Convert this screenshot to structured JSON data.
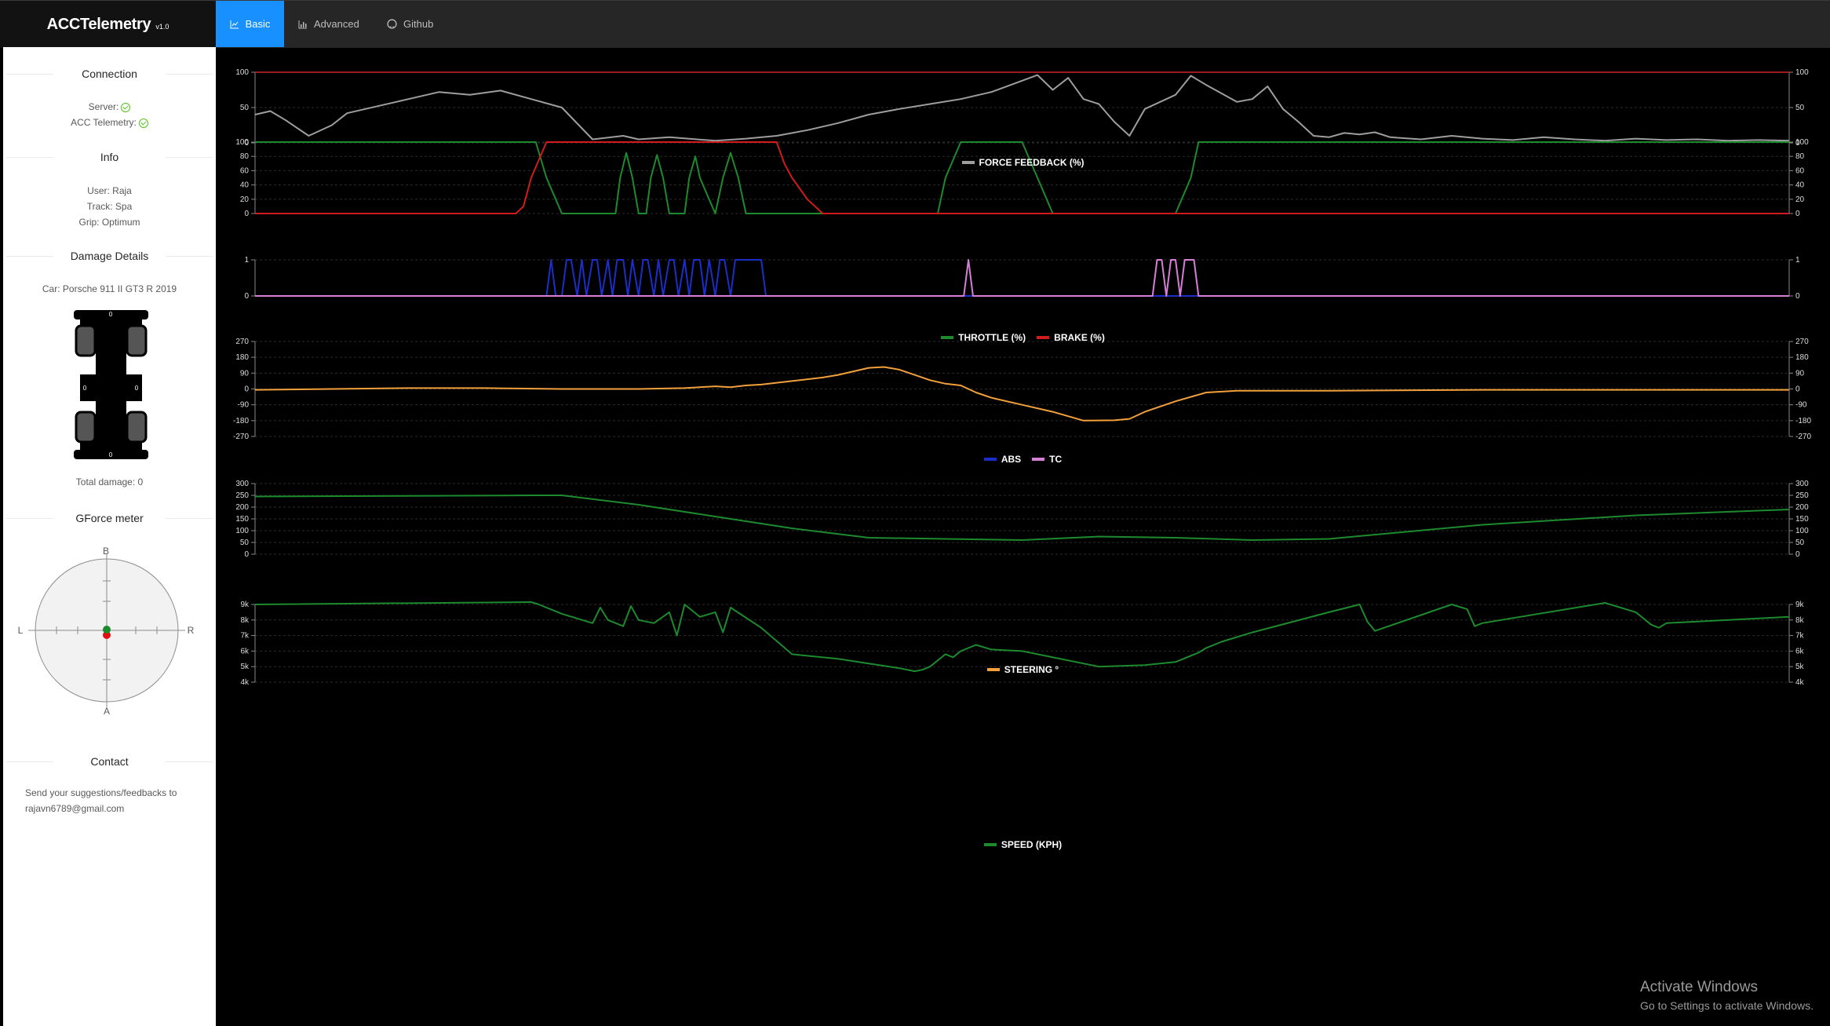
{
  "app": {
    "title": "ACCTelemetry",
    "version": "v1.0"
  },
  "nav": {
    "tabs": [
      "Basic",
      "Advanced",
      "Github"
    ],
    "active": "Basic",
    "accent": "#1890ff"
  },
  "sidebar": {
    "connection": {
      "title": "Connection",
      "server_label": "Server:",
      "telemetry_label": "ACC Telemetry:",
      "server_ok": true,
      "telemetry_ok": true
    },
    "info": {
      "title": "Info",
      "user": "User: Raja",
      "track": "Track: Spa",
      "grip": "Grip: Optimum"
    },
    "damage": {
      "title": "Damage Details",
      "car": "Car: Porsche 911 II GT3 R 2019",
      "front": "0",
      "rear": "0",
      "left": "0",
      "right": "0",
      "total": "Total damage: 0"
    },
    "gforce": {
      "title": "GForce meter",
      "top": "B",
      "bottom": "A",
      "left": "L",
      "right": "R"
    },
    "contact": {
      "title": "Contact",
      "line1": "Send your suggestions/feedbacks to",
      "email": "rajavn6789@gmail.com"
    }
  },
  "windows_notice": {
    "line1": "Activate Windows",
    "line2": "Go to Settings to activate Windows."
  },
  "chart_data": [
    {
      "type": "line",
      "ylim": [
        0,
        100
      ],
      "ticks": [
        "0",
        "50",
        "100"
      ],
      "series": [
        {
          "name": "FORCE FEEDBACK (%)",
          "color": "#9e9e9e",
          "x": [
            0,
            0.01,
            0.02,
            0.035,
            0.05,
            0.06,
            0.08,
            0.1,
            0.12,
            0.14,
            0.16,
            0.18,
            0.2,
            0.22,
            0.24,
            0.25,
            0.27,
            0.3,
            0.32,
            0.34,
            0.36,
            0.38,
            0.4,
            0.42,
            0.44,
            0.46,
            0.48,
            0.5,
            0.51,
            0.52,
            0.53,
            0.54,
            0.55,
            0.56,
            0.57,
            0.58,
            0.6,
            0.61,
            0.62,
            0.63,
            0.64,
            0.65,
            0.66,
            0.67,
            0.68,
            0.69,
            0.7,
            0.71,
            0.72,
            0.73,
            0.74,
            0.76,
            0.78,
            0.8,
            0.82,
            0.84,
            0.86,
            0.88,
            0.9,
            0.92,
            0.94,
            0.96,
            0.98,
            1.0
          ],
          "y": [
            40,
            45,
            32,
            10,
            25,
            42,
            52,
            62,
            72,
            68,
            74,
            62,
            50,
            5,
            10,
            5,
            8,
            3,
            6,
            10,
            18,
            28,
            40,
            48,
            55,
            62,
            72,
            88,
            96,
            75,
            92,
            62,
            55,
            30,
            10,
            48,
            68,
            95,
            82,
            70,
            58,
            62,
            80,
            48,
            30,
            10,
            8,
            14,
            12,
            15,
            8,
            5,
            10,
            6,
            4,
            8,
            5,
            3,
            6,
            4,
            5,
            3,
            4,
            3
          ]
        },
        {
          "name": "",
          "color": "#9b1c1c",
          "x": [
            0,
            1
          ],
          "y": [
            100,
            100
          ]
        }
      ]
    },
    {
      "type": "line",
      "ylim": [
        0,
        100
      ],
      "ticks": [
        "0",
        "20",
        "40",
        "60",
        "80",
        "100"
      ],
      "series": [
        {
          "name": "THROTTLE (%)",
          "color": "#1d8a2e",
          "x": [
            0,
            0.183,
            0.19,
            0.2,
            0.21,
            0.215,
            0.22,
            0.235,
            0.238,
            0.242,
            0.246,
            0.25,
            0.255,
            0.258,
            0.262,
            0.266,
            0.27,
            0.28,
            0.283,
            0.287,
            0.29,
            0.3,
            0.305,
            0.31,
            0.315,
            0.32,
            0.33,
            0.34,
            0.44,
            0.445,
            0.45,
            0.46,
            0.48,
            0.5,
            0.51,
            0.52,
            0.6,
            0.61,
            0.615,
            0.62,
            0.63,
            1.0
          ],
          "y": [
            100,
            100,
            50,
            0,
            0,
            0,
            0,
            0,
            50,
            85,
            50,
            0,
            0,
            50,
            82,
            50,
            0,
            0,
            50,
            80,
            50,
            0,
            50,
            85,
            50,
            0,
            0,
            0,
            0,
            0,
            50,
            100,
            100,
            100,
            50,
            0,
            0,
            50,
            100,
            100,
            100,
            100
          ]
        },
        {
          "name": "BRAKE (%)",
          "color": "#d01c1c",
          "x": [
            0,
            0.17,
            0.175,
            0.18,
            0.19,
            0.2,
            0.33,
            0.34,
            0.345,
            0.35,
            0.36,
            0.37,
            1.0
          ],
          "y": [
            0,
            0,
            10,
            50,
            100,
            100,
            100,
            100,
            70,
            50,
            20,
            0,
            0
          ]
        }
      ]
    },
    {
      "type": "line",
      "ylim": [
        0,
        1
      ],
      "ticks": [
        "0",
        "1"
      ],
      "series": [
        {
          "name": "ABS",
          "color": "#1c2ec9",
          "x": [
            0,
            0.19,
            0.193,
            0.196,
            0.2,
            0.203,
            0.206,
            0.21,
            0.213,
            0.216,
            0.22,
            0.223,
            0.226,
            0.23,
            0.233,
            0.236,
            0.24,
            0.243,
            0.246,
            0.25,
            0.253,
            0.256,
            0.26,
            0.263,
            0.266,
            0.27,
            0.273,
            0.276,
            0.28,
            0.283,
            0.286,
            0.29,
            0.293,
            0.296,
            0.3,
            0.303,
            0.306,
            0.31,
            0.313,
            0.316,
            0.32,
            0.323,
            0.326,
            0.33,
            0.333,
            0.336,
            1.0
          ],
          "y": [
            0,
            0,
            1,
            0,
            0,
            1,
            1,
            0,
            1,
            0,
            1,
            1,
            0,
            1,
            0,
            1,
            1,
            0,
            1,
            0,
            1,
            1,
            0,
            1,
            0,
            1,
            1,
            0,
            1,
            0,
            1,
            1,
            0,
            1,
            0,
            1,
            1,
            0,
            1,
            1,
            1,
            1,
            1,
            1,
            0,
            0,
            0
          ]
        },
        {
          "name": "TC",
          "color": "#d77fd7",
          "x": [
            0,
            0.462,
            0.465,
            0.468,
            0.47,
            0.585,
            0.588,
            0.591,
            0.594,
            0.597,
            0.6,
            0.603,
            0.606,
            0.609,
            0.612,
            0.615,
            0.618,
            1.0
          ],
          "y": [
            0,
            0,
            1,
            0,
            0,
            0,
            1,
            1,
            0,
            1,
            1,
            0,
            1,
            1,
            1,
            0,
            0,
            0
          ]
        }
      ]
    },
    {
      "type": "line",
      "ylim": [
        -270,
        270
      ],
      "ticks": [
        "-270",
        "-180",
        "-90",
        "0",
        "90",
        "180",
        "270"
      ],
      "series": [
        {
          "name": "STEERING °",
          "color": "#f2a03b",
          "x": [
            0,
            0.05,
            0.1,
            0.15,
            0.2,
            0.25,
            0.28,
            0.3,
            0.31,
            0.32,
            0.33,
            0.35,
            0.37,
            0.38,
            0.39,
            0.4,
            0.41,
            0.42,
            0.43,
            0.44,
            0.45,
            0.46,
            0.47,
            0.48,
            0.5,
            0.52,
            0.54,
            0.56,
            0.57,
            0.58,
            0.6,
            0.62,
            0.64,
            0.7,
            0.8,
            0.9,
            1.0
          ],
          "y": [
            -5,
            0,
            5,
            5,
            0,
            0,
            5,
            15,
            10,
            20,
            25,
            45,
            65,
            80,
            100,
            120,
            125,
            110,
            80,
            50,
            30,
            20,
            -20,
            -50,
            -90,
            -130,
            -180,
            -178,
            -170,
            -130,
            -70,
            -20,
            -10,
            -10,
            -5,
            -5,
            -5
          ]
        }
      ]
    },
    {
      "type": "line",
      "ylim": [
        0,
        300
      ],
      "ticks": [
        "0",
        "50",
        "100",
        "150",
        "200",
        "250",
        "300"
      ],
      "series": [
        {
          "name": "SPEED (KPH)",
          "color": "#1d8a2e",
          "x": [
            0,
            0.183,
            0.2,
            0.25,
            0.3,
            0.35,
            0.4,
            0.45,
            0.5,
            0.55,
            0.6,
            0.65,
            0.7,
            0.8,
            0.9,
            1.0
          ],
          "y": [
            245,
            250,
            250,
            210,
            160,
            110,
            70,
            65,
            60,
            75,
            70,
            60,
            65,
            125,
            165,
            190
          ]
        }
      ]
    },
    {
      "type": "line",
      "ylim": [
        4000,
        9000
      ],
      "ticks": [
        "4k",
        "5k",
        "6k",
        "7k",
        "8k",
        "9k"
      ],
      "series": [
        {
          "name": "",
          "color": "#1d8a2e",
          "x": [
            0,
            0.18,
            0.185,
            0.2,
            0.22,
            0.225,
            0.23,
            0.24,
            0.245,
            0.25,
            0.26,
            0.27,
            0.275,
            0.28,
            0.29,
            0.3,
            0.305,
            0.31,
            0.33,
            0.35,
            0.38,
            0.4,
            0.42,
            0.43,
            0.435,
            0.44,
            0.45,
            0.455,
            0.46,
            0.47,
            0.48,
            0.5,
            0.55,
            0.58,
            0.6,
            0.605,
            0.61,
            0.615,
            0.62,
            0.63,
            0.65,
            0.7,
            0.72,
            0.725,
            0.73,
            0.78,
            0.79,
            0.795,
            0.8,
            0.88,
            0.9,
            0.91,
            0.915,
            0.92,
            1.0
          ],
          "y": [
            9000,
            9150,
            9000,
            8400,
            7800,
            8800,
            8000,
            7600,
            8900,
            8000,
            7800,
            8500,
            7000,
            9000,
            8200,
            8500,
            7200,
            8800,
            7500,
            5800,
            5500,
            5200,
            4900,
            4700,
            4800,
            5000,
            5800,
            5600,
            6000,
            6400,
            6100,
            6000,
            5000,
            5100,
            5300,
            5500,
            5700,
            5900,
            6200,
            6600,
            7200,
            8500,
            9000,
            7900,
            7300,
            9000,
            8700,
            7600,
            7800,
            9100,
            8500,
            7700,
            7500,
            7800,
            8200
          ]
        }
      ]
    }
  ]
}
